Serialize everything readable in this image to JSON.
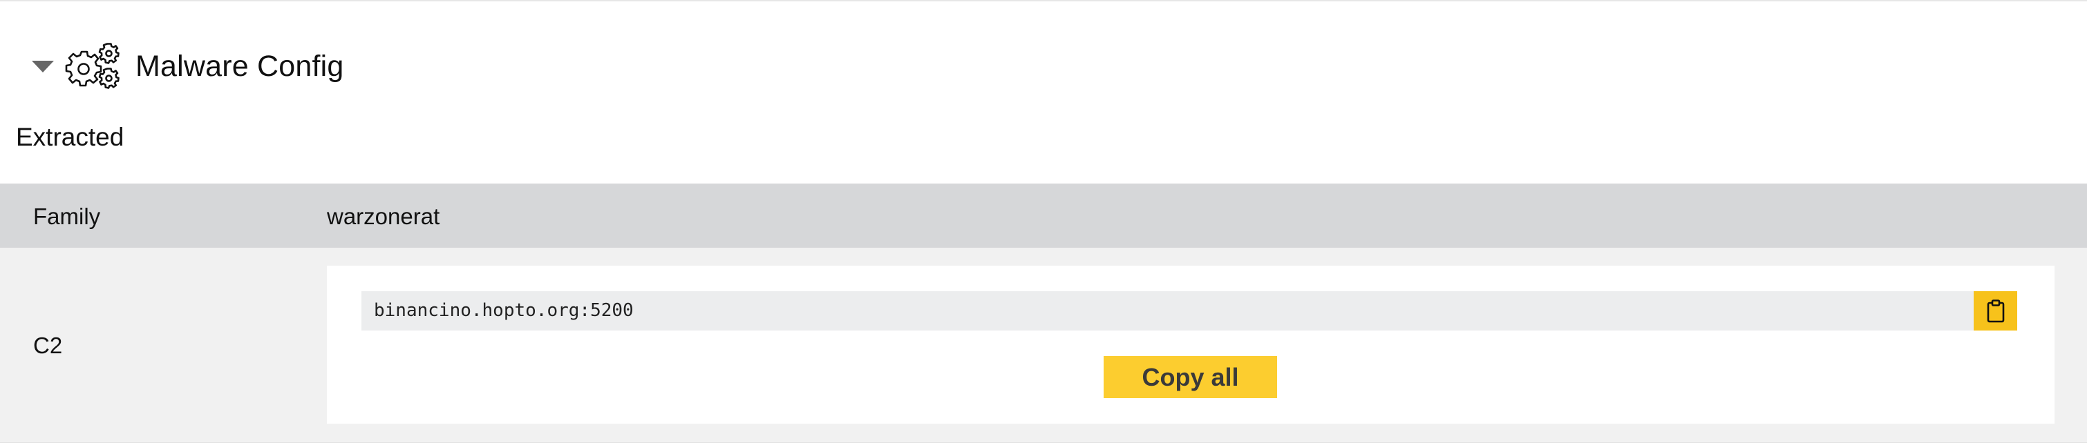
{
  "section": {
    "title": "Malware Config",
    "caret_icon": "caret-down-icon",
    "header_icon": "gears-icon"
  },
  "subsection": {
    "label": "Extracted"
  },
  "config": {
    "family": {
      "key": "Family",
      "value": "warzonerat"
    },
    "c2": {
      "key": "C2",
      "entries": [
        "binancino.hopto.org:5200"
      ],
      "copy_icon": "clipboard-icon",
      "copy_all_label": "Copy all"
    }
  },
  "colors": {
    "family_row_bg": "#d6d7d9",
    "c2_row_bg": "#f1f1f1",
    "accent_yellow": "#fccd2f",
    "clip_button_yellow": "#f7c21b"
  }
}
